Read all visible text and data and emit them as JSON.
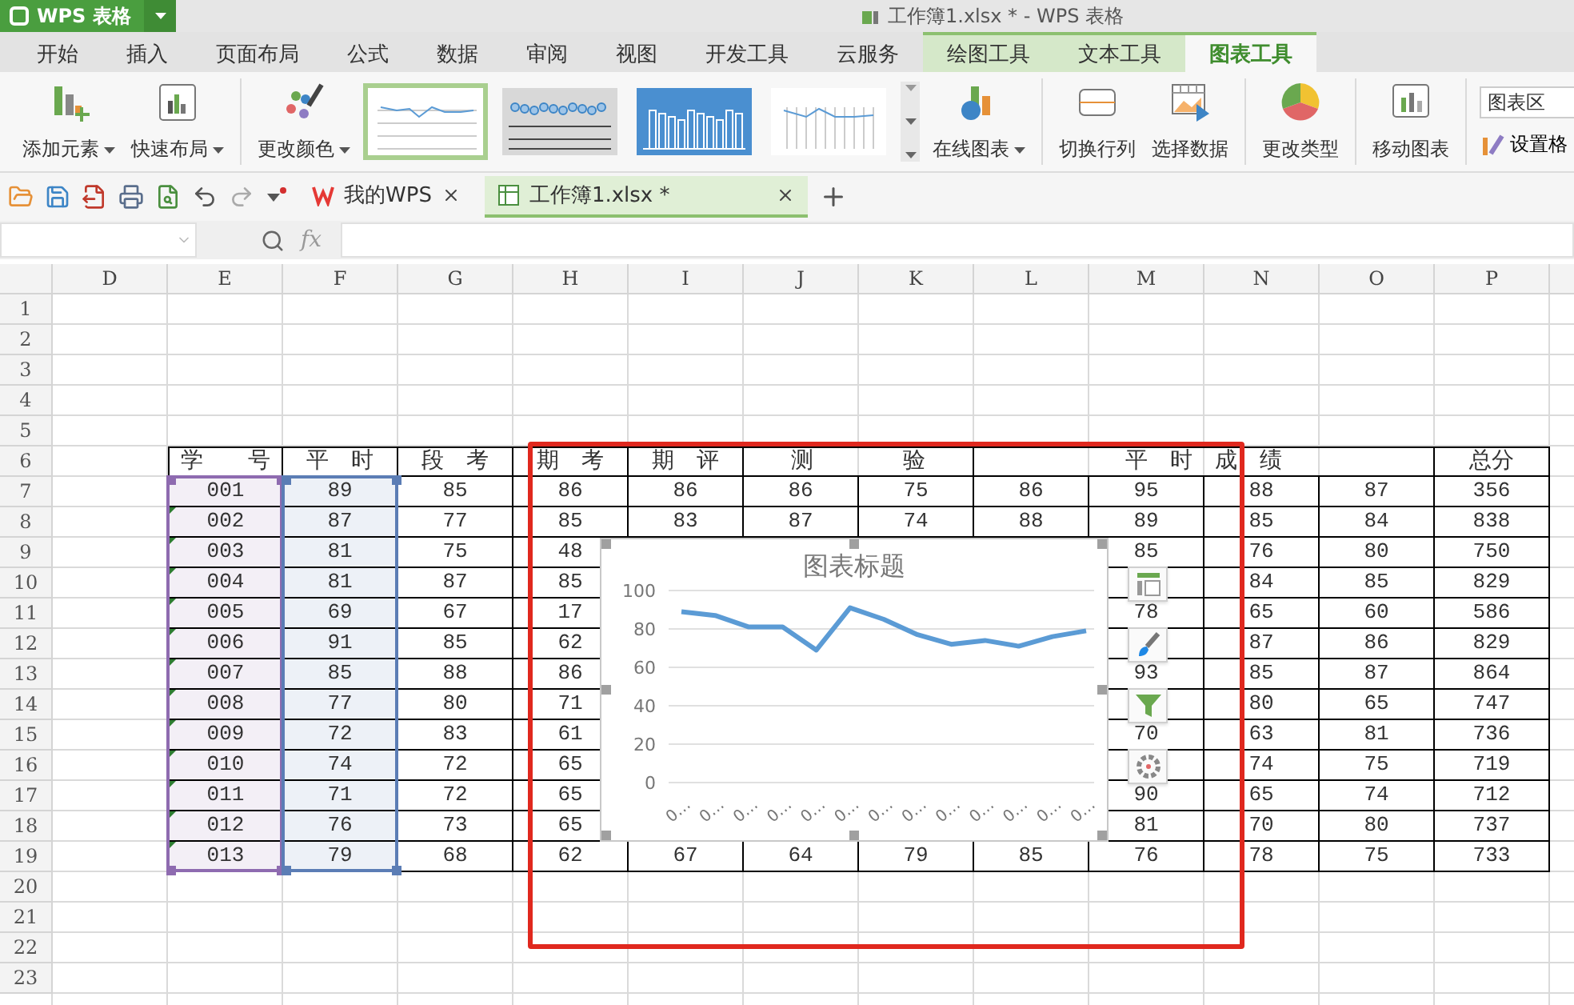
{
  "app_button": {
    "label": "WPS 表格"
  },
  "window": {
    "title": "工作簿1.xlsx * - WPS 表格"
  },
  "menu_tabs": [
    {
      "label": "开始",
      "kind": "main",
      "selected": false
    },
    {
      "label": "插入",
      "kind": "main",
      "selected": false
    },
    {
      "label": "页面布局",
      "kind": "main",
      "selected": false
    },
    {
      "label": "公式",
      "kind": "main",
      "selected": false
    },
    {
      "label": "数据",
      "kind": "main",
      "selected": false
    },
    {
      "label": "审阅",
      "kind": "main",
      "selected": false
    },
    {
      "label": "视图",
      "kind": "main",
      "selected": false
    },
    {
      "label": "开发工具",
      "kind": "main",
      "selected": false
    },
    {
      "label": "云服务",
      "kind": "main",
      "selected": false
    },
    {
      "label": "绘图工具",
      "kind": "context",
      "selected": false
    },
    {
      "label": "文本工具",
      "kind": "context",
      "selected": false
    },
    {
      "label": "图表工具",
      "kind": "context",
      "selected": true
    }
  ],
  "ribbon": {
    "groups": [
      {
        "items": [
          {
            "kind": "button",
            "label": "添加元素",
            "dropdown": true
          },
          {
            "kind": "button",
            "label": "快速布局",
            "dropdown": true
          }
        ]
      },
      {
        "items": [
          {
            "kind": "button",
            "label": "更改颜色",
            "dropdown": true
          },
          {
            "kind": "gallery",
            "styles": [
              {
                "kind": "line",
                "selected": true
              },
              {
                "kind": "markers",
                "selected": false
              },
              {
                "kind": "columns",
                "selected": false
              },
              {
                "kind": "area",
                "selected": false
              }
            ]
          },
          {
            "kind": "button",
            "label": "在线图表",
            "dropdown": true
          }
        ]
      },
      {
        "items": [
          {
            "kind": "button",
            "label": "切换行列"
          },
          {
            "kind": "button",
            "label": "选择数据"
          }
        ]
      },
      {
        "items": [
          {
            "kind": "button",
            "label": "更改类型"
          }
        ]
      },
      {
        "items": [
          {
            "kind": "button",
            "label": "移动图表"
          }
        ]
      },
      {
        "items": [
          {
            "kind": "select",
            "value": "图表区"
          },
          {
            "kind": "small-button",
            "label": "设置格"
          }
        ]
      }
    ]
  },
  "doc_tabs": [
    {
      "label": "我的WPS",
      "selected": false
    },
    {
      "label": "工作簿1.xlsx *",
      "selected": true
    }
  ],
  "formula_bar": {
    "fx_label": "fx"
  },
  "sheet": {
    "columns": [
      {
        "label": "D"
      },
      {
        "label": "E",
        "color": "#8e6bb0",
        "text_marks": true
      },
      {
        "label": "F",
        "color": "#5b7db5"
      },
      {
        "label": "G"
      },
      {
        "label": "H"
      },
      {
        "label": "I"
      },
      {
        "label": "J"
      },
      {
        "label": "K"
      },
      {
        "label": "L"
      },
      {
        "label": "M"
      },
      {
        "label": "N"
      },
      {
        "label": "O"
      },
      {
        "label": "P"
      }
    ],
    "rows": [
      {
        "number": "1",
        "kind": "empty"
      },
      {
        "number": "2",
        "kind": "empty"
      },
      {
        "number": "3",
        "kind": "empty"
      },
      {
        "number": "4",
        "kind": "empty"
      },
      {
        "number": "5",
        "kind": "empty"
      },
      {
        "number": "6",
        "kind": "header",
        "cells": [
          {
            "text": "学　　号",
            "kind": "single"
          },
          {
            "text": "平　时",
            "kind": "single"
          },
          {
            "text": "段　考",
            "kind": "single"
          },
          {
            "text": "期　考",
            "kind": "single"
          },
          {
            "text": "期　评",
            "kind": "single"
          },
          {
            "text": "测　　　　验",
            "kind": "pair"
          },
          {
            "text": "平　时　成　绩",
            "kind": "quad"
          },
          {
            "text": "总分",
            "kind": "single"
          }
        ]
      },
      {
        "number": "7",
        "kind": "data",
        "cells": [
          "001",
          "89",
          "85",
          "86",
          "86",
          "86",
          "75",
          "86",
          "95",
          "88",
          "87",
          "356"
        ]
      },
      {
        "number": "8",
        "kind": "data",
        "cells": [
          "002",
          "87",
          "77",
          "85",
          "83",
          "87",
          "74",
          "88",
          "89",
          "85",
          "84",
          "838"
        ]
      },
      {
        "number": "9",
        "kind": "data",
        "cells": [
          "003",
          "81",
          "75",
          "48",
          null,
          null,
          null,
          null,
          "85",
          "76",
          "80",
          "750"
        ]
      },
      {
        "number": "10",
        "kind": "data",
        "cells": [
          "004",
          "81",
          "87",
          "85",
          null,
          null,
          null,
          null,
          null,
          "84",
          "85",
          "829"
        ]
      },
      {
        "number": "11",
        "kind": "data",
        "cells": [
          "005",
          "69",
          "67",
          "17",
          null,
          null,
          null,
          null,
          "78",
          "65",
          "60",
          "586"
        ]
      },
      {
        "number": "12",
        "kind": "data",
        "cells": [
          "006",
          "91",
          "85",
          "62",
          null,
          null,
          null,
          null,
          null,
          "87",
          "86",
          "829"
        ]
      },
      {
        "number": "13",
        "kind": "data",
        "cells": [
          "007",
          "85",
          "88",
          "86",
          null,
          null,
          null,
          null,
          "93",
          "85",
          "87",
          "864"
        ]
      },
      {
        "number": "14",
        "kind": "data",
        "cells": [
          "008",
          "77",
          "80",
          "71",
          null,
          null,
          null,
          null,
          null,
          "80",
          "65",
          "747"
        ]
      },
      {
        "number": "15",
        "kind": "data",
        "cells": [
          "009",
          "72",
          "83",
          "61",
          null,
          null,
          null,
          null,
          "70",
          "63",
          "81",
          "736"
        ]
      },
      {
        "number": "16",
        "kind": "data",
        "cells": [
          "010",
          "74",
          "72",
          "65",
          null,
          null,
          null,
          null,
          null,
          "74",
          "75",
          "719"
        ]
      },
      {
        "number": "17",
        "kind": "data",
        "cells": [
          "011",
          "71",
          "72",
          "65",
          null,
          null,
          null,
          null,
          "90",
          "65",
          "74",
          "712"
        ]
      },
      {
        "number": "18",
        "kind": "data",
        "cells": [
          "012",
          "76",
          "73",
          "65",
          null,
          null,
          null,
          null,
          "81",
          "70",
          "80",
          "737"
        ]
      },
      {
        "number": "19",
        "kind": "data",
        "cells": [
          "013",
          "79",
          "68",
          "62",
          "67",
          "64",
          "79",
          "85",
          "76",
          "78",
          "75",
          "733"
        ]
      },
      {
        "number": "20",
        "kind": "empty"
      },
      {
        "number": "21",
        "kind": "empty"
      },
      {
        "number": "22",
        "kind": "empty"
      },
      {
        "number": "23",
        "kind": "empty"
      }
    ]
  },
  "chart": {
    "chart_data": {
      "type": "line",
      "title": "图表标题",
      "categories": [
        "0…",
        "0…",
        "0…",
        "0…",
        "0…",
        "0…",
        "0…",
        "0…",
        "0…",
        "0…",
        "0…",
        "0…",
        "0…"
      ],
      "series": [
        {
          "color": "#5b9bd5",
          "values": [
            89,
            87,
            81,
            81,
            69,
            91,
            85,
            77,
            72,
            74,
            71,
            76,
            79
          ]
        }
      ],
      "ylim": [
        0,
        100
      ],
      "yticks": [
        0,
        20,
        40,
        60,
        80,
        100
      ],
      "grid": true
    }
  }
}
